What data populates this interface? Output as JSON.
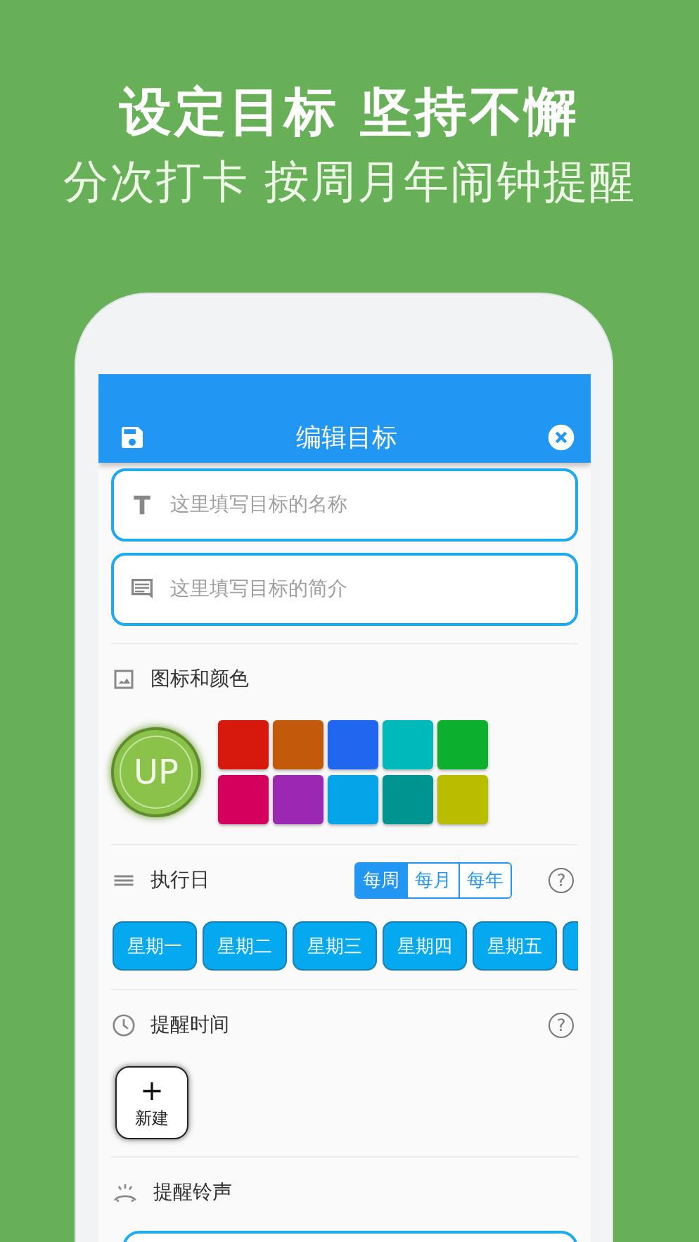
{
  "headline": "设定目标 坚持不懈",
  "subheadline": "分次打卡 按周月年闹钟提醒",
  "app_bar": {
    "title": "编辑目标"
  },
  "fields": [
    {
      "kind": "title",
      "placeholder": "这里填写目标的名称"
    },
    {
      "kind": "comment",
      "placeholder": "这里填写目标的简介"
    }
  ],
  "icon_section": {
    "label": "图标和颜色",
    "icon_label": "UP",
    "colors": [
      {
        "color": "#d7190d"
      },
      {
        "color": "#c25a0b"
      },
      {
        "color": "#2166ee"
      },
      {
        "color": "#00b9b9"
      },
      {
        "color": "#0cb02e"
      },
      {
        "color": "#d5005e"
      },
      {
        "color": "#9c27b0"
      },
      {
        "color": "#03a4e8"
      },
      {
        "color": "#009491"
      },
      {
        "color": "#b9bd00"
      }
    ]
  },
  "schedule": {
    "label": "执行日",
    "help": "?",
    "modes": [
      {
        "label": "每周",
        "selected": true
      },
      {
        "label": "每月",
        "selected": false
      },
      {
        "label": "每年",
        "selected": false
      }
    ],
    "days": [
      {
        "label": "星期一",
        "selected": true
      },
      {
        "label": "星期二",
        "selected": true
      },
      {
        "label": "星期三",
        "selected": true
      },
      {
        "label": "星期四",
        "selected": true
      },
      {
        "label": "星期五",
        "selected": true
      },
      {
        "selected": true
      }
    ]
  },
  "reminder": {
    "label": "提醒时间",
    "help": "?",
    "add_symbol": "+",
    "add_label": "新建"
  },
  "ringtone": {
    "label": "提醒铃声"
  }
}
